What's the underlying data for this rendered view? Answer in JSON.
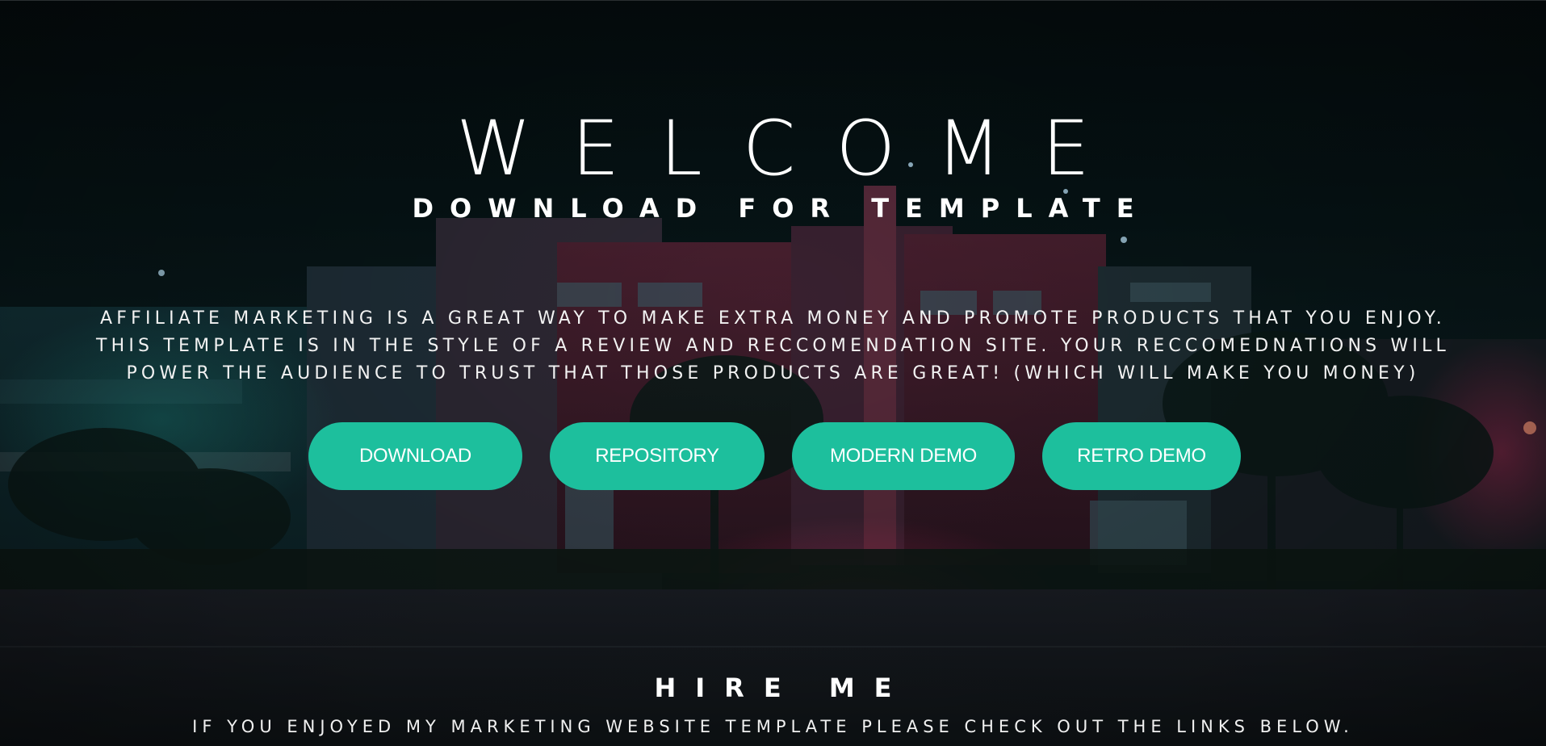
{
  "hero": {
    "title": "WELCOME",
    "subtitle": "DOWNLOAD FOR TEMPLATE",
    "description_lines": [
      "AFFILIATE MARKETING IS A GREAT WAY TO MAKE EXTRA MONEY AND PROMOTE PRODUCTS THAT YOU ENJOY.",
      "THIS TEMPLATE IS IN THE STYLE OF A REVIEW AND RECCOMENDATION SITE. YOUR RECCOMEDNATIONS WILL",
      "POWER THE AUDIENCE TO TRUST THAT THOSE PRODUCTS ARE GREAT! (WHICH WILL MAKE YOU MONEY)"
    ]
  },
  "buttons": {
    "download": "DOWNLOAD",
    "repository": "REPOSITORY",
    "modern_demo": "MODERN DEMO",
    "retro_demo": "RETRO DEMO"
  },
  "hire": {
    "title": "HIRE ME",
    "text": "IF YOU ENJOYED MY MARKETING WEBSITE TEMPLATE PLEASE CHECK OUT THE LINKS BELOW."
  },
  "colors": {
    "accent": "#1dbf9d",
    "background": "#061214",
    "text": "#ffffff"
  }
}
